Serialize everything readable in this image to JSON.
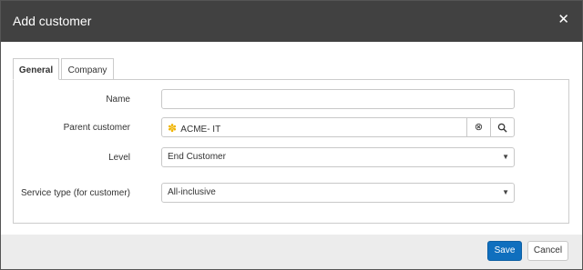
{
  "dialog": {
    "title": "Add customer",
    "close_symbol": "✕"
  },
  "tabs": [
    {
      "label": "General",
      "active": true
    },
    {
      "label": "Company",
      "active": false
    }
  ],
  "form": {
    "name": {
      "label": "Name",
      "value": ""
    },
    "parent_customer": {
      "label": "Parent customer",
      "value": "ACME- IT",
      "badge_icon": "customer-icon"
    },
    "level": {
      "label": "Level",
      "value": "End Customer"
    },
    "service_type": {
      "label": "Service type (for customer)",
      "value": "All-inclusive"
    }
  },
  "footer": {
    "save_label": "Save",
    "cancel_label": "Cancel"
  },
  "colors": {
    "titlebar": "#414141",
    "primary": "#0f6fbe",
    "badge": "#f0b400"
  }
}
